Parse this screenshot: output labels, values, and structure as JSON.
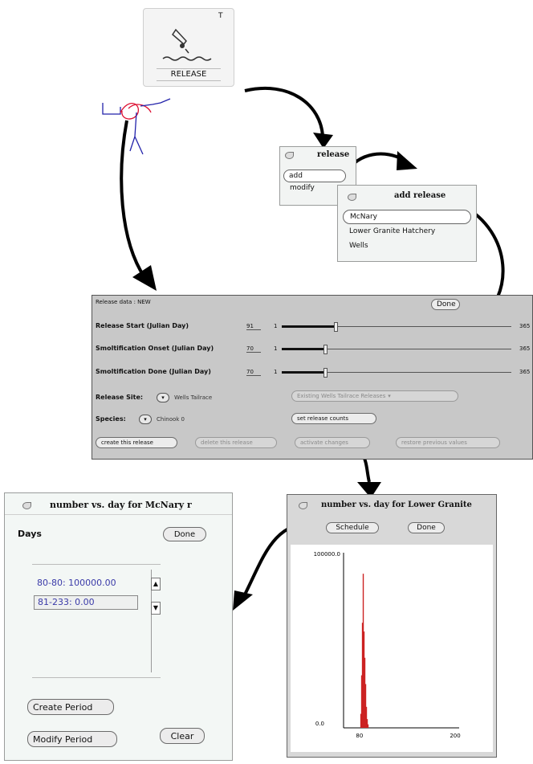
{
  "release_icon": {
    "label": "RELEASE",
    "corner_mark": "T"
  },
  "release_menu": {
    "title": "release",
    "items": [
      "add",
      "modify"
    ]
  },
  "add_release_menu": {
    "title": "add release",
    "items": [
      "McNary",
      "Lower Granite Hatchery",
      "Wells"
    ]
  },
  "release_data": {
    "header": "Release data : NEW",
    "done_label": "Done",
    "rows": [
      {
        "label": "Release Start (Julian Day)",
        "value": "91",
        "min": "1",
        "max": "365"
      },
      {
        "label": "Smoltification Onset (Julian Day)",
        "value": "70",
        "min": "1",
        "max": "365"
      },
      {
        "label": "Smoltification Done (Julian Day)",
        "value": "70",
        "min": "1",
        "max": "365"
      }
    ],
    "site_label": "Release Site:",
    "site_value": "Wells Tailrace",
    "existing_label": "Existing Wells Tailrace Releases",
    "species_label": "Species:",
    "species_value": "Chinook 0",
    "counts_button": "set release counts",
    "bottom_buttons": [
      "create this release",
      "delete this release",
      "activate changes",
      "restore previous values"
    ]
  },
  "mcnary_window": {
    "title": "number vs. day for McNary r",
    "days_label": "Days",
    "done_label": "Done",
    "list_items": [
      "80-80: 100000.00",
      "81-233: 0.00"
    ],
    "create_button": "Create Period",
    "modify_button": "Modify Period",
    "clear_button": "Clear"
  },
  "granite_window": {
    "title": "number vs. day for Lower Granite",
    "schedule_label": "Schedule",
    "done_label": "Done"
  },
  "chart_data": {
    "type": "bar",
    "ylim": [
      0,
      100000
    ],
    "ytick_labels": [
      "100000.0",
      "0.0"
    ],
    "xtick_labels": [
      "80",
      "200"
    ],
    "x": [
      80,
      81,
      82,
      83,
      84,
      85,
      86,
      87,
      88,
      89,
      90
    ],
    "values": [
      0,
      8000,
      30000,
      60000,
      88000,
      55000,
      40000,
      25000,
      12000,
      5000,
      2000
    ],
    "bar_color": "#cc2222"
  }
}
